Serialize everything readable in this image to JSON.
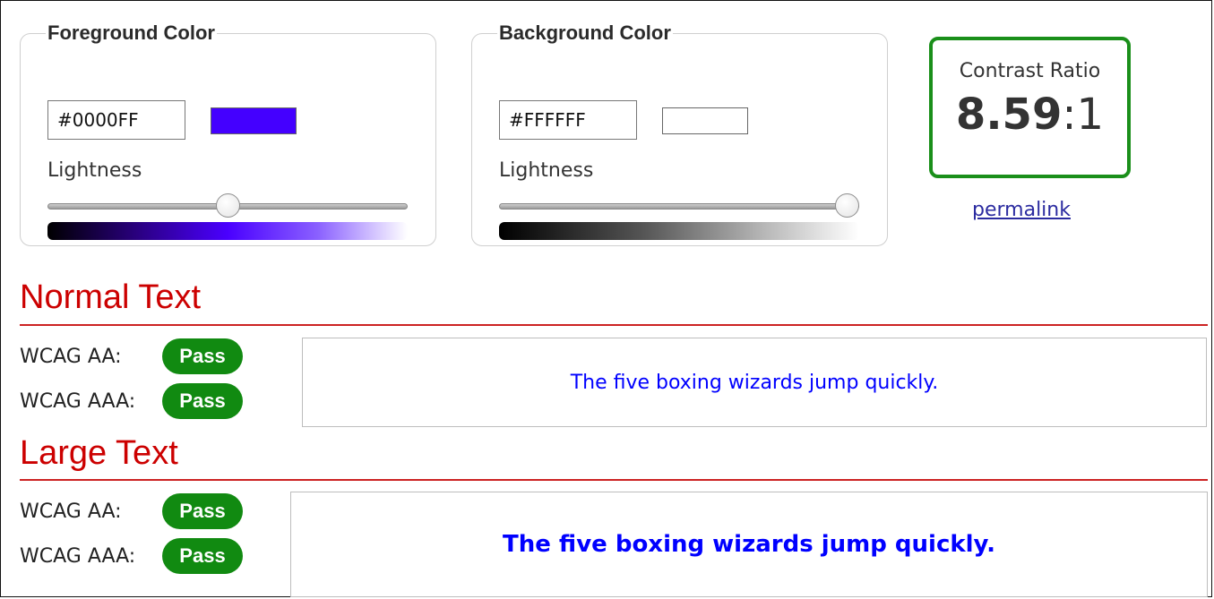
{
  "foreground": {
    "legend": "Foreground Color",
    "hex_value": "#0000FF",
    "swatch_color": "#4400ff",
    "lightness_label": "Lightness",
    "lightness_level_percent": 50
  },
  "background": {
    "legend": "Background Color",
    "hex_value": "#FFFFFF",
    "swatch_color": "#ffffff",
    "lightness_label": "Lightness",
    "lightness_level_percent": 100
  },
  "contrast": {
    "label": "Contrast Ratio",
    "ratio": "8.59",
    "suffix": ":1",
    "border_color": "#1a8f1a"
  },
  "permalink_label": "permalink",
  "normal_text": {
    "heading": "Normal Text",
    "wcag_aa_label": "WCAG AA:",
    "wcag_aa_result": "Pass",
    "wcag_aaa_label": "WCAG AAA:",
    "wcag_aaa_result": "Pass",
    "sample": "The five boxing wizards jump quickly."
  },
  "large_text": {
    "heading": "Large Text",
    "wcag_aa_label": "WCAG AA:",
    "wcag_aa_result": "Pass",
    "wcag_aaa_label": "WCAG AAA:",
    "wcag_aaa_result": "Pass",
    "sample": "The five boxing wizards jump quickly."
  },
  "colors": {
    "pass_badge": "#118a11",
    "heading_red": "#cc0000",
    "sample_text": "#0000ff"
  }
}
